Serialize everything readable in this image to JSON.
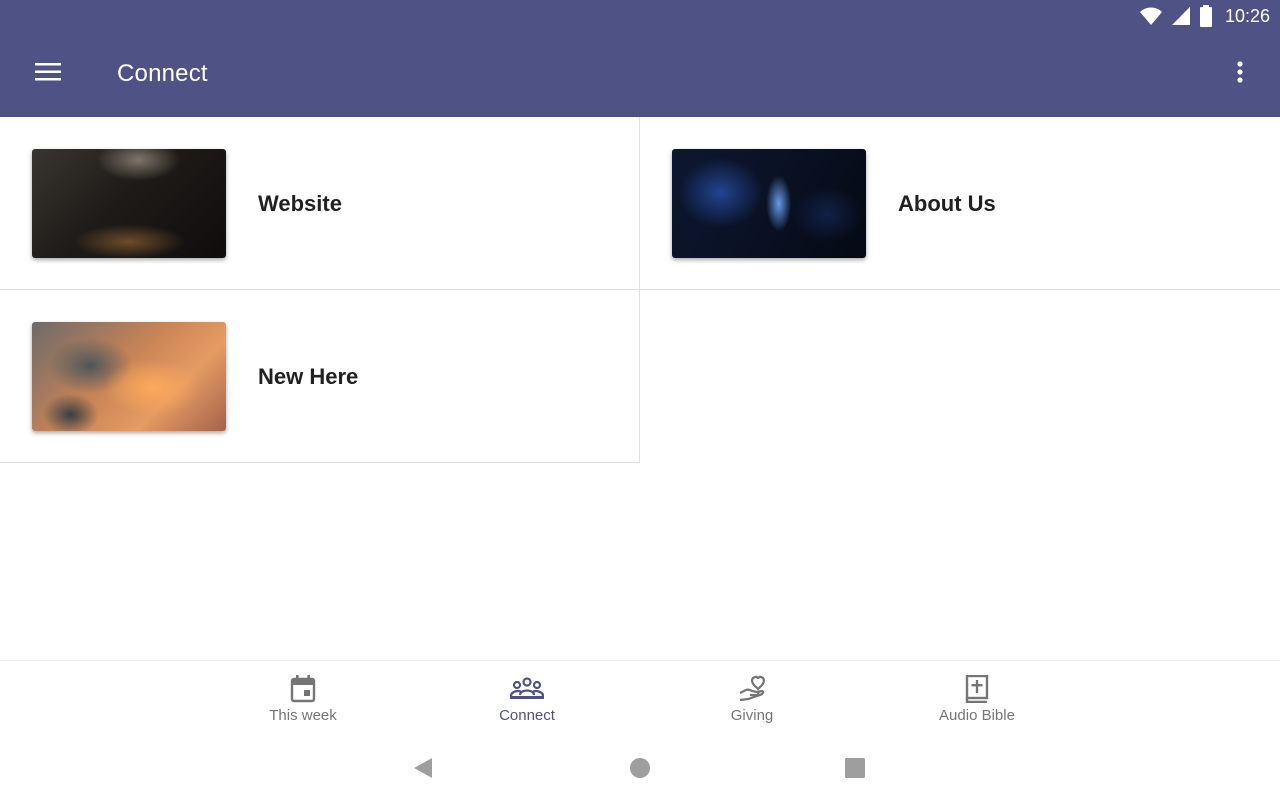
{
  "status_bar": {
    "time": "10:26",
    "icons": [
      "wifi-icon",
      "cell-signal-icon",
      "battery-icon"
    ]
  },
  "app_bar": {
    "title": "Connect",
    "menu_icon": "hamburger-menu-icon",
    "overflow_icon": "more-vert-icon",
    "color": "#4f5284"
  },
  "tiles": [
    {
      "label": "Website",
      "image": "concert-crowd-photo"
    },
    {
      "label": "About Us",
      "image": "worship-stage-photo"
    },
    {
      "label": "New Here",
      "image": "sunset-clouds-photo"
    }
  ],
  "bottom_nav": {
    "items": [
      {
        "label": "This week",
        "icon": "calendar-icon",
        "active": false
      },
      {
        "label": "Connect",
        "icon": "people-group-icon",
        "active": true
      },
      {
        "label": "Giving",
        "icon": "hand-heart-icon",
        "active": false
      },
      {
        "label": "Audio Bible",
        "icon": "bible-icon",
        "active": false
      }
    ],
    "active_color": "#4f5284",
    "inactive_color": "#757575"
  },
  "system_nav": {
    "icons": [
      "back-triangle-icon",
      "home-circle-icon",
      "recents-square-icon"
    ]
  }
}
